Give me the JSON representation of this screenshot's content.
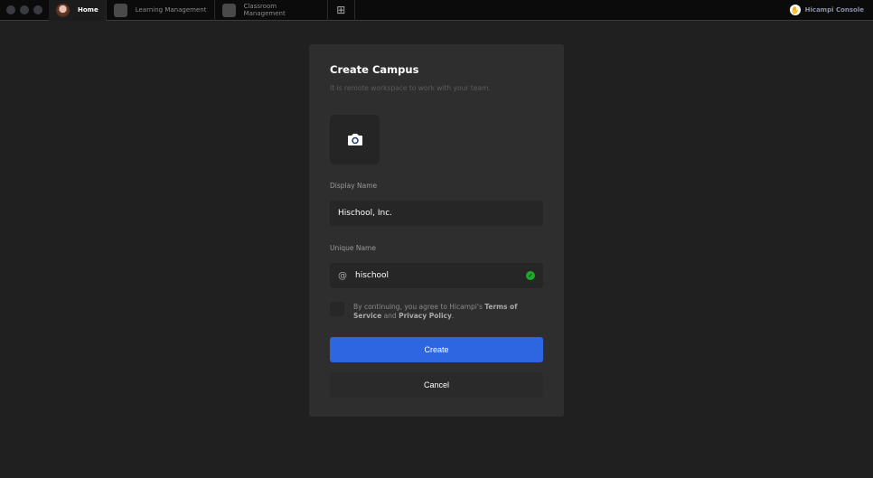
{
  "tabs": {
    "home": "Home",
    "learning": "Learning Management",
    "classroom": "Classroom Management",
    "add": "⊞"
  },
  "brand": "Hicampi Console",
  "dialog": {
    "title": "Create Campus",
    "subtitle": "It is remote workspace to work with your team.",
    "display_label": "Display Name",
    "display_value": "Hischool, Inc.",
    "unique_label": "Unique Name",
    "unique_prefix": "@",
    "unique_value": "hischool",
    "terms_pre": "By continuing, you agree to Hicampi's ",
    "terms_link": "Terms of Service",
    "terms_mid": " and ",
    "privacy_link": "Privacy Policy",
    "terms_end": ".",
    "create": "Create",
    "cancel": "Cancel"
  }
}
